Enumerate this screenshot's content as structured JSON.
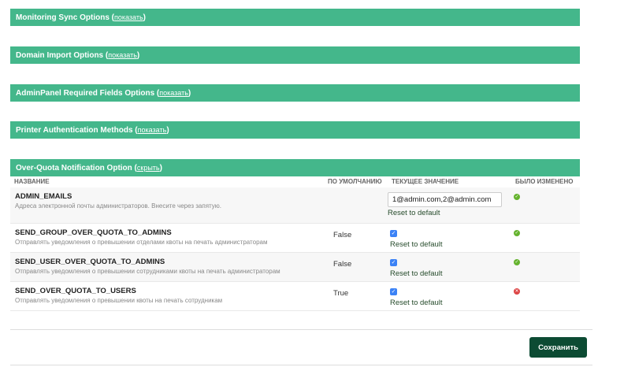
{
  "sections": [
    {
      "title": "Monitoring Sync Options",
      "toggle": "показать"
    },
    {
      "title": "Domain Import Options",
      "toggle": "показать"
    },
    {
      "title": "AdminPanel Required Fields Options",
      "toggle": "показать"
    },
    {
      "title": "Printer Authentication Methods",
      "toggle": "показать"
    },
    {
      "title": "Over-Quota Notification Option",
      "toggle": "скрыть"
    }
  ],
  "table": {
    "headers": {
      "name": "НАЗВАНИЕ",
      "default": "ПО УМОЛЧАНИЮ",
      "current": "ТЕКУЩЕЕ ЗНАЧЕНИЕ",
      "changed": "БЫЛО ИЗМЕНЕНО"
    },
    "rows": [
      {
        "name": "ADMIN_EMAILS",
        "description": "Адреса электронной почты администраторов. Внесите через запятую.",
        "default": "",
        "value": "1@admin.com,2@admin.com",
        "reset": "Reset to default",
        "changed": true
      },
      {
        "name": "SEND_GROUP_OVER_QUOTA_TO_ADMINS",
        "description": "Отправлять уведомления о превышении отделами квоты на печать администраторам",
        "default": "False",
        "checked": true,
        "reset": "Reset to default",
        "changed": true
      },
      {
        "name": "SEND_USER_OVER_QUOTA_TO_ADMINS",
        "description": "Отправлять уведомления о превышении сотрудниками квоты на печать администраторам",
        "default": "False",
        "checked": true,
        "reset": "Reset to default",
        "changed": true
      },
      {
        "name": "SEND_OVER_QUOTA_TO_USERS",
        "description": "Отправлять уведомления о превышении квоты на печать сотрудникам",
        "default": "True",
        "checked": true,
        "reset": "Reset to default",
        "changed": false
      }
    ]
  },
  "save_label": "Сохранить",
  "colors": {
    "header_bg": "#44b78b",
    "save_bg": "#0c4b33",
    "check": "#3b82f6",
    "ok": "#65b32e",
    "no": "#dd4646"
  }
}
